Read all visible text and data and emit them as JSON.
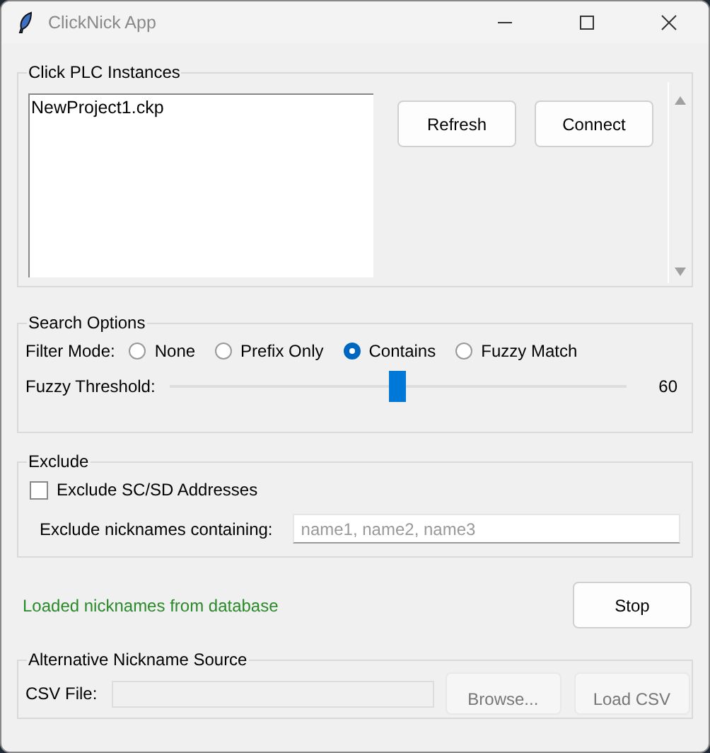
{
  "window": {
    "title": "ClickNick App"
  },
  "instances": {
    "title": "Click PLC Instances",
    "items": [
      {
        "label": "NewProject1.ckp",
        "selected": false
      }
    ],
    "buttons": [
      {
        "label": "Refresh",
        "disabled": false
      },
      {
        "label": "Connect",
        "disabled": false
      }
    ]
  },
  "search_options": {
    "title": "Search Options",
    "filter_label": "Filter Mode:",
    "modes": [
      {
        "label": "None",
        "selected": false
      },
      {
        "label": "Prefix Only",
        "selected": false
      },
      {
        "label": "Contains",
        "selected": true
      },
      {
        "label": "Fuzzy Match",
        "selected": false
      }
    ],
    "threshold_label": "Fuzzy Threshold:",
    "threshold": {
      "level": 0.5
    },
    "threshold_value": "60"
  },
  "exclude": {
    "title": "Exclude",
    "checkbox": {
      "label": "Exclude SC/SD Addresses",
      "checked": false
    },
    "nicknames_label": "Exclude nicknames containing:",
    "nicknames_field": {
      "placeholder": "name1, name2, name3"
    }
  },
  "status": "Loaded nicknames from database",
  "stop_button": {
    "label": "Stop",
    "disabled": false
  },
  "alt_source": {
    "title": "Alternative Nickname Source",
    "csv_label": "CSV File:",
    "csv_field": {
      "disabled": true
    },
    "buttons": [
      {
        "label": "Browse...",
        "disabled": true
      },
      {
        "label": "Load CSV",
        "disabled": true
      }
    ]
  }
}
